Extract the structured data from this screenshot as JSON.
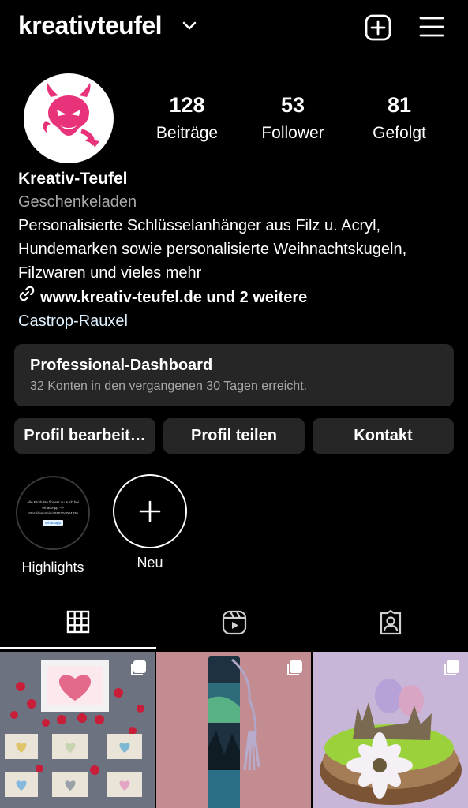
{
  "header": {
    "username": "kreativteufel",
    "icons": [
      "chevron-down-icon",
      "add-post-icon",
      "menu-icon"
    ]
  },
  "profile": {
    "stats": [
      {
        "value": "128",
        "label": "Beiträge"
      },
      {
        "value": "53",
        "label": "Follower"
      },
      {
        "value": "81",
        "label": "Gefolgt"
      }
    ],
    "name": "Kreativ-Teufel",
    "category": "Geschenkeladen",
    "bio_lines": [
      "Personalisierte Schlüsselanhänger aus Filz u. Acryl,",
      "Hundemarken sowie personalisierte Weihnachtskugeln,",
      "Filzwaren und vieles mehr"
    ],
    "link": "www.kreativ-teufel.de und 2 weitere",
    "location": "Castrop-Rauxel"
  },
  "dashboard": {
    "title": "Professional-Dashboard",
    "subtitle": "32 Konten in den vergangenen 30 Tagen erreicht."
  },
  "actions": {
    "edit": "Profil bearbeit…",
    "share": "Profil teilen",
    "contact": "Kontakt"
  },
  "highlights": [
    {
      "label": "Highlights",
      "thumb_lines": [
        "Alle Produkte findest du auch bei",
        "WhatsApp -->",
        "https://wa.me/c/4915204084336"
      ],
      "thumb_button": "Whatsapp"
    },
    {
      "label": "Neu"
    }
  ],
  "tabs": [
    "grid-icon",
    "reels-icon",
    "tagged-icon"
  ],
  "colors": {
    "background": "#000000",
    "surface": "#262626",
    "secondary_text": "#a8a8a8",
    "brand_pink": "#e8327a"
  }
}
